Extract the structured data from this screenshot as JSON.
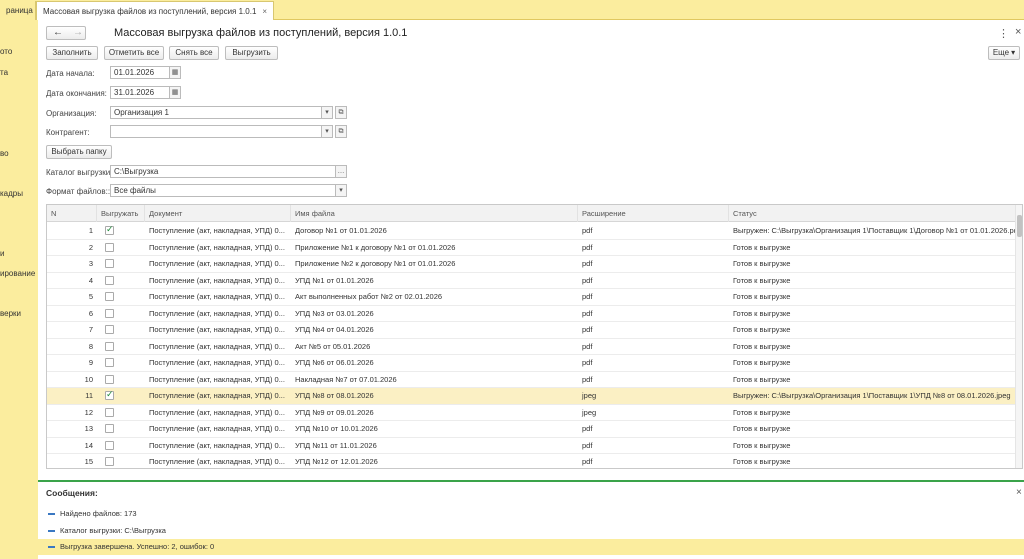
{
  "tabs": {
    "home_label": "раница",
    "active_label": "Массовая выгрузка файлов из поступлений, версия 1.0.1",
    "close_glyph": "×"
  },
  "sidebar": {
    "items": [
      "ото",
      "та",
      "во",
      "кадры",
      "и",
      "ирование",
      "верки"
    ]
  },
  "form": {
    "title": "Массовая выгрузка файлов из поступлений, версия 1.0.1",
    "more_label": "Еще",
    "buttons": {
      "fill": "Заполнить",
      "check_all": "Отметить все",
      "uncheck_all": "Снять все",
      "export": "Выгрузить",
      "choose_folder": "Выбрать папку"
    },
    "fields": {
      "date_start_label": "Дата начала:",
      "date_start_value": "01.01.2026",
      "date_end_label": "Дата окончания:",
      "date_end_value": "31.01.2026",
      "org_label": "Организация:",
      "org_value": "Организация 1",
      "contractor_label": "Контрагент:",
      "contractor_value": "",
      "catalog_label": "Каталог выгрузки:",
      "catalog_value": "C:\\Выгрузка",
      "format_label": "Формат файлов::",
      "format_value": "Все файлы"
    }
  },
  "table": {
    "headers": {
      "n": "N",
      "export": "Выгружать",
      "document": "Документ",
      "filename": "Имя файла",
      "extension": "Расширение",
      "status": "Статус"
    },
    "rows": [
      {
        "n": "1",
        "checked": true,
        "doc": "Поступление (акт, накладная, УПД) 0...",
        "file": "Договор №1 от 01.01.2026",
        "ext": "pdf",
        "status": "Выгружен: C:\\Выгрузка\\Организация 1\\Поставщик 1\\Договор №1 от 01.01.2026.pdf"
      },
      {
        "n": "2",
        "checked": false,
        "doc": "Поступление (акт, накладная, УПД) 0...",
        "file": "Приложение №1 к договору №1 от 01.01.2026",
        "ext": "pdf",
        "status": "Готов к выгрузке"
      },
      {
        "n": "3",
        "checked": false,
        "doc": "Поступление (акт, накладная, УПД) 0...",
        "file": "Приложение №2 к договору №1 от 01.01.2026",
        "ext": "pdf",
        "status": "Готов к выгрузке"
      },
      {
        "n": "4",
        "checked": false,
        "doc": "Поступление (акт, накладная, УПД) 0...",
        "file": "УПД №1 от 01.01.2026",
        "ext": "pdf",
        "status": "Готов к выгрузке"
      },
      {
        "n": "5",
        "checked": false,
        "doc": "Поступление (акт, накладная, УПД) 0...",
        "file": "Акт выполненных работ №2 от 02.01.2026",
        "ext": "pdf",
        "status": "Готов к выгрузке"
      },
      {
        "n": "6",
        "checked": false,
        "doc": "Поступление (акт, накладная, УПД) 0...",
        "file": "УПД №3 от 03.01.2026",
        "ext": "pdf",
        "status": "Готов к выгрузке"
      },
      {
        "n": "7",
        "checked": false,
        "doc": "Поступление (акт, накладная, УПД) 0...",
        "file": "УПД №4 от 04.01.2026",
        "ext": "pdf",
        "status": "Готов к выгрузке"
      },
      {
        "n": "8",
        "checked": false,
        "doc": "Поступление (акт, накладная, УПД) 0...",
        "file": "Акт №5 от 05.01.2026",
        "ext": "pdf",
        "status": "Готов к выгрузке"
      },
      {
        "n": "9",
        "checked": false,
        "doc": "Поступление (акт, накладная, УПД) 0...",
        "file": "УПД №6 от 06.01.2026",
        "ext": "pdf",
        "status": "Готов к выгрузке"
      },
      {
        "n": "10",
        "checked": false,
        "doc": "Поступление (акт, накладная, УПД) 0...",
        "file": "Накладная №7 от 07.01.2026",
        "ext": "pdf",
        "status": "Готов к выгрузке"
      },
      {
        "n": "11",
        "checked": true,
        "doc": "Поступление (акт, накладная, УПД) 0...",
        "file": "УПД №8 от 08.01.2026",
        "ext": "jpeg",
        "status": "Выгружен: C:\\Выгрузка\\Организация 1\\Поставщик 1\\УПД №8 от 08.01.2026.jpeg"
      },
      {
        "n": "12",
        "checked": false,
        "doc": "Поступление (акт, накладная, УПД) 0...",
        "file": "УПД №9 от 09.01.2026",
        "ext": "jpeg",
        "status": "Готов к выгрузке"
      },
      {
        "n": "13",
        "checked": false,
        "doc": "Поступление (акт, накладная, УПД) 0...",
        "file": "УПД №10 от 10.01.2026",
        "ext": "pdf",
        "status": "Готов к выгрузке"
      },
      {
        "n": "14",
        "checked": false,
        "doc": "Поступление (акт, накладная, УПД) 0...",
        "file": "УПД №11 от 11.01.2026",
        "ext": "pdf",
        "status": "Готов к выгрузке"
      },
      {
        "n": "15",
        "checked": false,
        "doc": "Поступление (акт, накладная, УПД) 0...",
        "file": "УПД №12 от 12.01.2026",
        "ext": "pdf",
        "status": "Готов к выгрузке"
      }
    ],
    "selected_row": "11"
  },
  "messages": {
    "title": "Сообщения:",
    "close_glyph": "×",
    "items": [
      "Найдено файлов: 173",
      "Каталог выгрузки: C:\\Выгрузка",
      "Выгрузка завершена. Успешно: 2, ошибок: 0"
    ]
  },
  "colors": {
    "accent_yellow": "#fbed9e",
    "selected_row": "#fbf0c4",
    "messages_bar": "#3aa34a",
    "checkmark": "#1f8a3a"
  }
}
